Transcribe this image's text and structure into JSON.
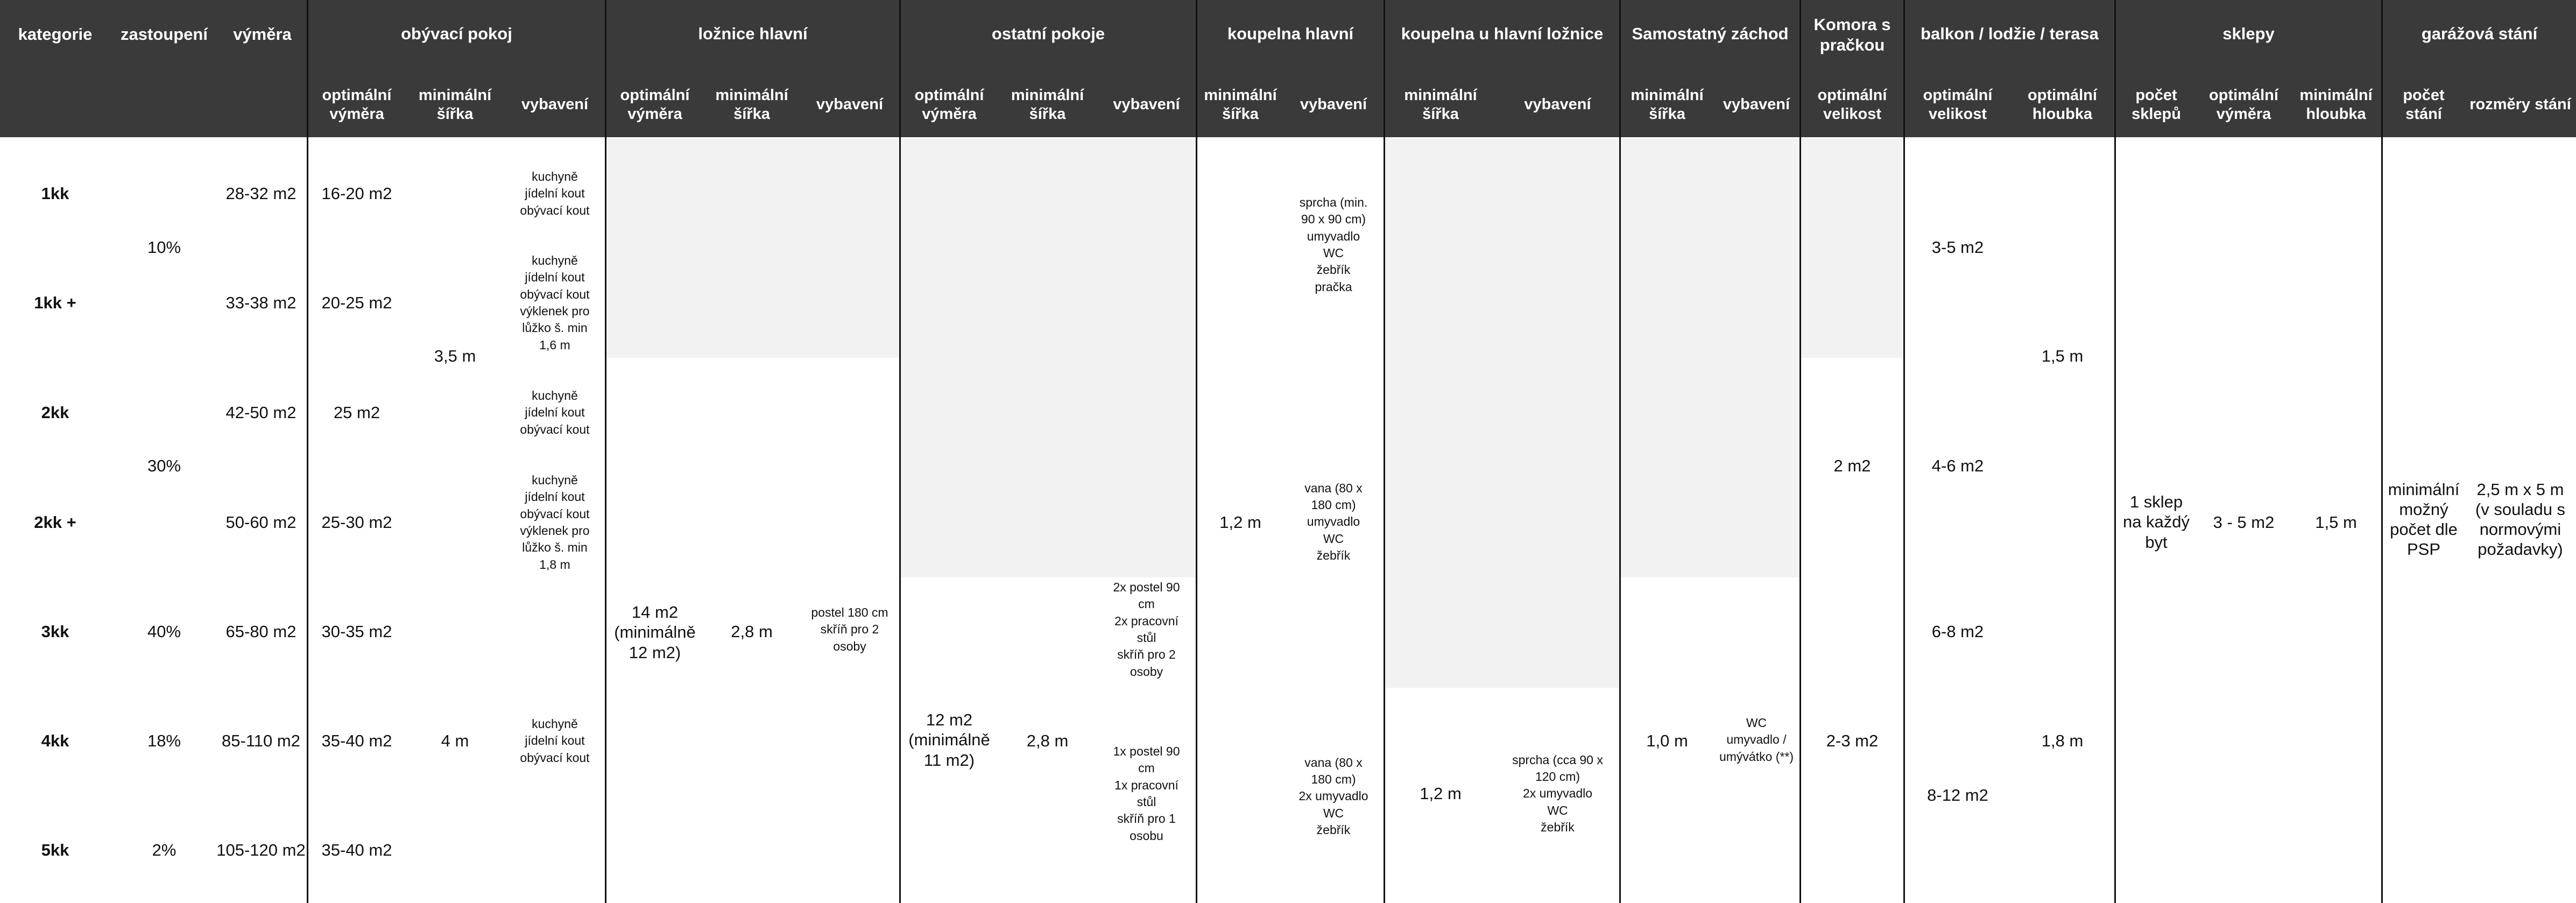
{
  "header": {
    "kategorie": "kategorie",
    "zastoupeni": "zastoupení",
    "vymera": "výměra",
    "groups": {
      "obyvaci": "obývací pokoj",
      "loznice": "ložnice hlavní",
      "ostatni": "ostatní pokoje",
      "koupelna": "koupelna hlavní",
      "koupelna_loz": "koupelna u hlavní ložnice",
      "zachod": "Samostatný záchod",
      "komora": "Komora s pračkou",
      "balkon": "balkon / lodžie / terasa",
      "sklepy": "sklepy",
      "garaz": "garážová stání"
    },
    "sub": {
      "opt_vymera": "optimální výměra",
      "min_sirka": "minimální šířka",
      "vybaveni": "vybavení",
      "opt_velikost": "optimální velikost",
      "opt_hloubka": "optimální hloubka",
      "pocet_sklepu": "počet sklepů",
      "min_hloubka": "minimální hloubka",
      "pocet_stani": "počet stání",
      "rozmery_stani": "rozměry stání"
    }
  },
  "rows": [
    {
      "kategorie": "1kk",
      "vymera": "28-32 m2",
      "obyvaci_vymera": "16-20 m2",
      "obyvaci_vybaveni": "kuchyně\njídelní kout\nobývací kout",
      "balkon": ""
    },
    {
      "kategorie": "1kk +",
      "vymera": "33-38 m2",
      "obyvaci_vymera": "20-25 m2",
      "obyvaci_vybaveni": "kuchyně\njídelní kout\nobývací kout\nvýklenek pro\nlůžko š. min\n1,6 m"
    },
    {
      "kategorie": "2kk",
      "vymera": "42-50 m2",
      "obyvaci_vymera": "25 m2",
      "obyvaci_vybaveni": "kuchyně\njídelní kout\nobývací kout"
    },
    {
      "kategorie": "2kk +",
      "vymera": "50-60 m2",
      "obyvaci_vymera": "25-30 m2",
      "obyvaci_vybaveni": "kuchyně\njídelní kout\nobývací kout\nvýklenek pro\nlůžko š. min\n1,8 m"
    },
    {
      "kategorie": "3kk",
      "zastoupeni": "40%",
      "vymera": "65-80 m2",
      "obyvaci_vymera": "30-35 m2",
      "balkon": "6-8 m2"
    },
    {
      "kategorie": "4kk",
      "zastoupeni": "18%",
      "vymera": "85-110 m2",
      "obyvaci_vymera": "35-40 m2",
      "obyvaci_vybaveni": "kuchyně\njídelní kout\nobývací kout"
    },
    {
      "kategorie": "5kk",
      "zastoupeni": "2%",
      "vymera": "105-120 m2",
      "obyvaci_vymera": "35-40 m2"
    }
  ],
  "merged": {
    "zast_1": "10%",
    "zast_2": "30%",
    "obyvaci_sirka_1": "3,5 m",
    "obyvaci_sirka_2": "4 m",
    "loznice_vymera": "14 m2\n(minimálně\n12 m2)",
    "loznice_sirka": "2,8 m",
    "loznice_vybaveni": "postel 180 cm\nskříň pro 2\nosoby",
    "ostatni_vymera": "12 m2\n(minimálně\n11 m2)",
    "ostatni_sirka": "2,8 m",
    "ostatni_vybaveni_1": "2x postel 90\ncm\n2x pracovní\nstůl\nskříň pro 2\nosoby",
    "ostatni_vybaveni_2": "1x postel 90\ncm\n1x pracovní\nstůl\nskříň pro 1\nosobu",
    "koupelna_sirka": "1,2 m",
    "koupelna_vyb_1": "sprcha (min.\n90 x 90 cm)\numyvadlo\nWC\nžebřík\npračka",
    "koupelna_vyb_2": "vana (80 x\n180 cm)\numyvadlo\nWC\nžebřík",
    "koupelna_vyb_3": "vana (80 x\n180 cm)\n2x umyvadlo\nWC\nžebřík",
    "koup_loz_sirka": "1,2 m",
    "koup_loz_vyb": "sprcha (cca 90 x\n120 cm)\n2x umyvadlo\nWC\nžebřík",
    "zachod_sirka": "1,0 m",
    "zachod_vyb": "WC\numyvadlo /\numývátko (**)",
    "komora_1": "2 m2",
    "komora_2": "2-3 m2",
    "balkon_1": "3-5 m2",
    "balkon_2": "4-6 m2",
    "balkon_3": "8-12 m2",
    "balkon_hloubka_1": "1,5 m",
    "balkon_hloubka_2": "1,8 m",
    "sklepy_pocet": "1 sklep\nna každý\nbyt",
    "sklepy_vymera": "3 - 5 m2",
    "sklepy_hloubka": "1,5 m",
    "garaz_pocet": "minimální\nmožný\npočet dle\nPSP",
    "garaz_rozmery": "2,5 m x 5 m\n(v souladu s\nnormovými\npožadavky)"
  },
  "colors": {
    "header": "#3a3a3a",
    "shade": "#f2f2f2",
    "lines": "#111111"
  }
}
